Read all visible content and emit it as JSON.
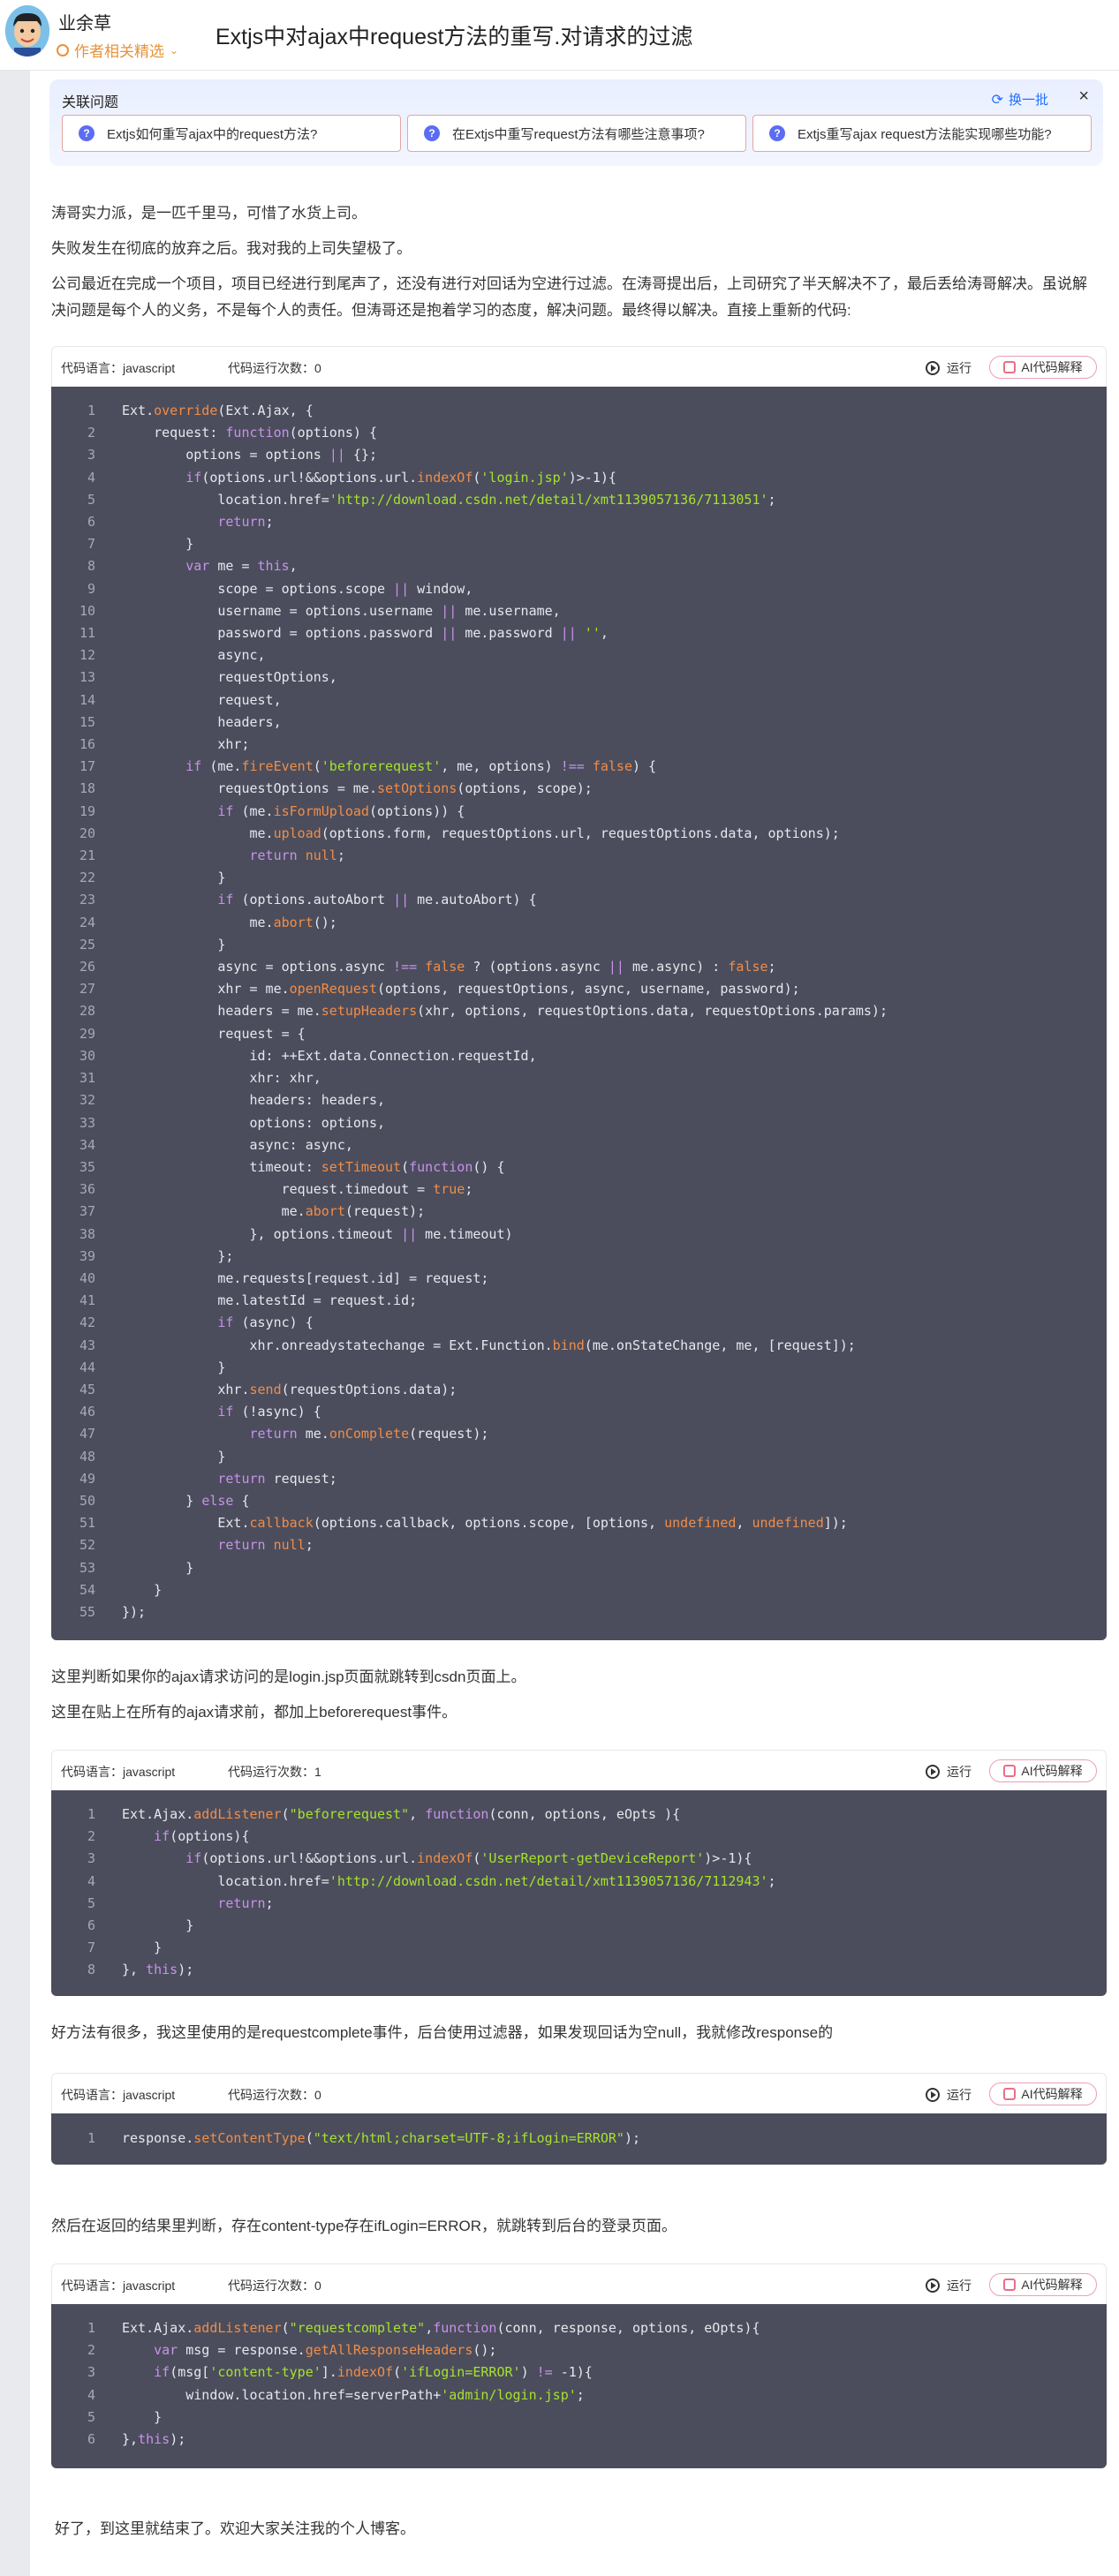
{
  "header": {
    "author": "业余草",
    "badge": "作者相关精选",
    "title": "Extjs中对ajax中request方法的重写.对请求的过滤"
  },
  "related": {
    "title": "关联问题",
    "refresh": "换一批",
    "questions": [
      "Extjs如何重写ajax中的request方法?",
      "在Extjs中重写request方法有哪些注意事项?",
      "Extjs重写ajax request方法能实现哪些功能?"
    ]
  },
  "paragraphs": {
    "p1": "涛哥实力派，是一匹千里马，可惜了水货上司。",
    "p2": "失败发生在彻底的放弃之后。我对我的上司失望极了。",
    "p3": "公司最近在完成一个项目，项目已经进行到尾声了，还没有进行对回话为空进行过滤。在涛哥提出后，上司研究了半天解决不了，最后丢给涛哥解决。虽说解决问题是每个人的义务，不是每个人的责任。但涛哥还是抱着学习的态度，解决问题。最终得以解决。直接上重新的代码:",
    "p4": "这里判断如果你的ajax请求访问的是login.jsp页面就跳转到csdn页面上。",
    "p5": "这里在贴上在所有的ajax请求前，都加上beforerequest事件。",
    "p6": "好方法有很多，我这里使用的是requestcomplete事件，后台使用过滤器，如果发现回话为空null，我就修改response的",
    "p7": "然后在返回的结果里判断，存在content-type存在ifLogin=ERROR，就跳转到后台的登录页面。",
    "p8": "好了，到这里就结束了。欢迎大家关注我的个人博客。"
  },
  "code_ui": {
    "lang": "代码语言：javascript",
    "run": "运行",
    "ai": "AI代码解释",
    "count0": "代码运行次数：0",
    "count1": "代码运行次数：1"
  },
  "code_blocks": [
    [
      "Ext.override(Ext.Ajax, {",
      "    request: function(options) {",
      "        options = options || {};",
      "        if(options.url!&&options.url.indexOf('login.jsp')>-1){",
      "            location.href='http://download.csdn.net/detail/xmt1139057136/7113051';",
      "            return;",
      "        }",
      "        var me = this,",
      "            scope = options.scope || window,",
      "            username = options.username || me.username,",
      "            password = options.password || me.password || '',",
      "            async,",
      "            requestOptions,",
      "            request,",
      "            headers,",
      "            xhr;",
      "        if (me.fireEvent('beforerequest', me, options) !== false) {",
      "            requestOptions = me.setOptions(options, scope);",
      "            if (me.isFormUpload(options)) {",
      "                me.upload(options.form, requestOptions.url, requestOptions.data, options);",
      "                return null;",
      "            }",
      "            if (options.autoAbort || me.autoAbort) {",
      "                me.abort();",
      "            }",
      "            async = options.async !== false ? (options.async || me.async) : false;",
      "            xhr = me.openRequest(options, requestOptions, async, username, password);",
      "            headers = me.setupHeaders(xhr, options, requestOptions.data, requestOptions.params);",
      "            request = {",
      "                id: ++Ext.data.Connection.requestId,",
      "                xhr: xhr,",
      "                headers: headers,",
      "                options: options,",
      "                async: async,",
      "                timeout: setTimeout(function() {",
      "                    request.timedout = true;",
      "                    me.abort(request);",
      "                }, options.timeout || me.timeout)",
      "            };",
      "            me.requests[request.id] = request;",
      "            me.latestId = request.id;",
      "            if (async) {",
      "                xhr.onreadystatechange = Ext.Function.bind(me.onStateChange, me, [request]);",
      "            }",
      "            xhr.send(requestOptions.data);",
      "            if (!async) {",
      "                return me.onComplete(request);",
      "            }",
      "            return request;",
      "        } else {",
      "            Ext.callback(options.callback, options.scope, [options, undefined, undefined]);",
      "            return null;",
      "        }",
      "    }",
      "});"
    ],
    [
      "Ext.Ajax.addListener(\"beforerequest\", function(conn, options, eOpts ){",
      "    if(options){",
      "        if(options.url!&&options.url.indexOf('UserReport-getDeviceReport')>-1){",
      "            location.href='http://download.csdn.net/detail/xmt1139057136/7112943';",
      "            return;",
      "        }",
      "    }",
      "}, this);"
    ],
    [
      "response.setContentType(\"text/html;charset=UTF-8;ifLogin=ERROR\");"
    ],
    [
      "Ext.Ajax.addListener(\"requestcomplete\",function(conn, response, options, eOpts){",
      "    var msg = response.getAllResponseHeaders();",
      "    if(msg['content-type'].indexOf('ifLogin=ERROR') != -1){",
      "        window.location.href=serverPath+'admin/login.jsp';",
      "    }",
      "},this);"
    ]
  ]
}
